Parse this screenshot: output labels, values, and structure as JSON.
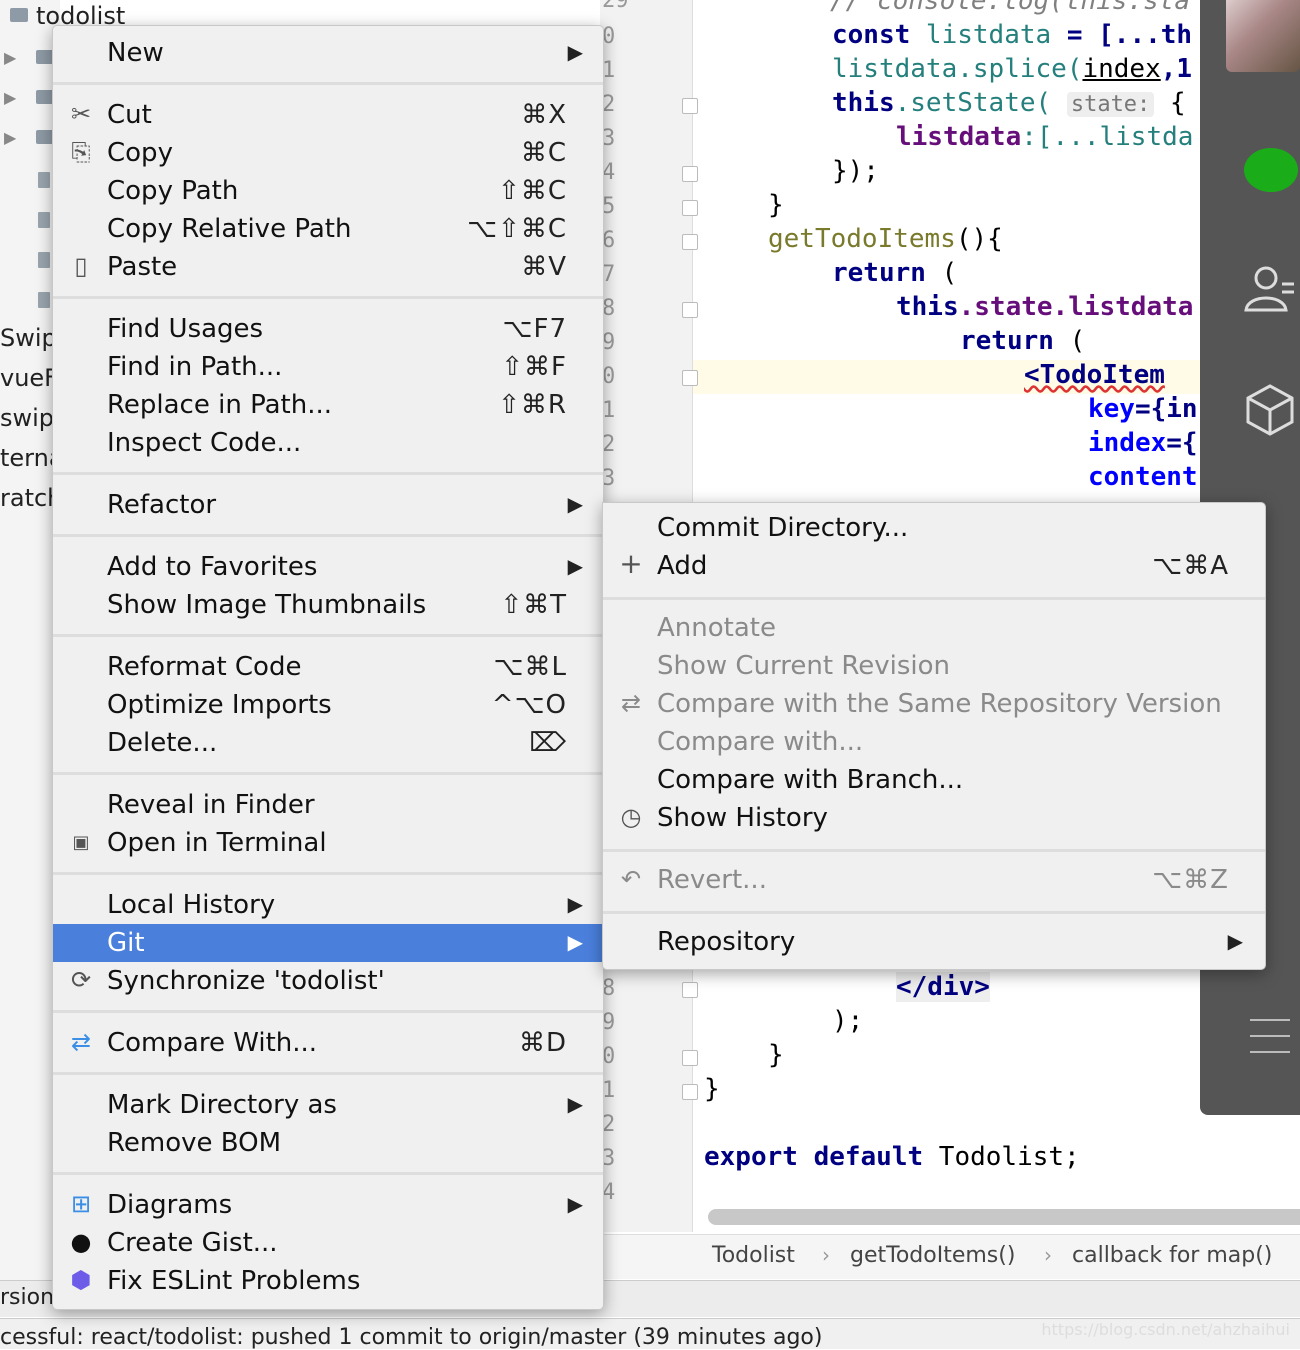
{
  "project_tree": {
    "root": "todolist",
    "partial_labels": [
      "Swip",
      "vueF",
      "swip",
      "terna",
      "ratch"
    ]
  },
  "editor": {
    "line_numbers": [
      "29",
      "0",
      "1",
      "2",
      "3",
      "4",
      "5",
      "6",
      "7",
      "8",
      "9",
      "0",
      "1",
      "2",
      "3",
      "8",
      "9",
      "0",
      "1",
      "2",
      "3",
      "4"
    ],
    "code": {
      "l0": "// console.log(this.sta",
      "l1a": "const",
      "l1b": " listdata",
      "l1c": " = [...th",
      "l2a": "listdata",
      "l2b": ".splice(",
      "l2c": "index",
      "l2d": ",1",
      "l3a": "this",
      "l3b": ".setState(",
      "l3hint": "state:",
      "l3c": " {",
      "l4a": "listdata",
      "l4b": ":[...listda",
      "l5": "});",
      "l6": "}",
      "l7a": "getTodoItems",
      "l7b": "(){",
      "l8a": "return",
      "l8b": " (",
      "l9a": "this",
      "l9b": ".state.listdata",
      "l10a": "return",
      "l10b": " (",
      "l11": "<TodoItem",
      "l12a": "key",
      "l12b": "={in",
      "l13a": "index",
      "l13b": "={",
      "l14a": "content",
      "l15": "</div>",
      "l16": ");",
      "l17": "}",
      "l18": "}",
      "l19a": "export default",
      "l19b": " Todolist;"
    },
    "breadcrumbs": [
      "Todolist",
      "getTodoItems()",
      "callback for map()"
    ]
  },
  "main_menu": {
    "items": [
      {
        "label": "New",
        "shortcut": "",
        "submenu": true
      },
      {
        "label": "Cut",
        "shortcut": "⌘X",
        "icon": "scissors-icon"
      },
      {
        "label": "Copy",
        "shortcut": "⌘C",
        "icon": "copy-icon"
      },
      {
        "label": "Copy Path",
        "shortcut": "⇧⌘C"
      },
      {
        "label": "Copy Relative Path",
        "shortcut": "⌥⇧⌘C"
      },
      {
        "label": "Paste",
        "shortcut": "⌘V",
        "icon": "paste-icon"
      },
      {
        "label": "Find Usages",
        "shortcut": "⌥F7"
      },
      {
        "label": "Find in Path...",
        "shortcut": "⇧⌘F"
      },
      {
        "label": "Replace in Path...",
        "shortcut": "⇧⌘R"
      },
      {
        "label": "Inspect Code..."
      },
      {
        "label": "Refactor",
        "submenu": true
      },
      {
        "label": "Add to Favorites",
        "submenu": true
      },
      {
        "label": "Show Image Thumbnails",
        "shortcut": "⇧⌘T"
      },
      {
        "label": "Reformat Code",
        "shortcut": "⌥⌘L"
      },
      {
        "label": "Optimize Imports",
        "shortcut": "^⌥O"
      },
      {
        "label": "Delete...",
        "shortcut": "⌦"
      },
      {
        "label": "Reveal in Finder"
      },
      {
        "label": "Open in Terminal",
        "icon": "terminal-icon"
      },
      {
        "label": "Local History",
        "submenu": true
      },
      {
        "label": "Git",
        "submenu": true,
        "selected": true
      },
      {
        "label": "Synchronize 'todolist'",
        "icon": "sync-icon"
      },
      {
        "label": "Compare With...",
        "shortcut": "⌘D",
        "icon": "compare-icon"
      },
      {
        "label": "Mark Directory as",
        "submenu": true
      },
      {
        "label": "Remove BOM"
      },
      {
        "label": "Diagrams",
        "submenu": true,
        "icon": "diagram-icon"
      },
      {
        "label": "Create Gist...",
        "icon": "github-icon"
      },
      {
        "label": "Fix ESLint Problems",
        "icon": "eslint-icon"
      }
    ],
    "arrow_glyph": "▶"
  },
  "git_submenu": {
    "items": [
      {
        "label": "Commit Directory...",
        "enabled": true
      },
      {
        "label": "Add",
        "shortcut": "⌥⌘A",
        "icon": "plus-icon",
        "enabled": true
      },
      {
        "label": "Annotate",
        "enabled": false
      },
      {
        "label": "Show Current Revision",
        "enabled": false
      },
      {
        "label": "Compare with the Same Repository Version",
        "enabled": false,
        "icon": "compare-icon"
      },
      {
        "label": "Compare with...",
        "enabled": false
      },
      {
        "label": "Compare with Branch...",
        "enabled": true
      },
      {
        "label": "Show History",
        "enabled": true,
        "icon": "clock-icon"
      },
      {
        "label": "Revert...",
        "shortcut": "⌥⌘Z",
        "enabled": false,
        "icon": "revert-icon"
      },
      {
        "label": "Repository",
        "submenu": true,
        "enabled": true
      }
    ]
  },
  "bottom": {
    "tool_label": "rsion",
    "status_text": "cessful: react/todolist: pushed 1 commit to origin/master (39 minutes ago)",
    "watermark": "https://blog.csdn.net/ahzhaihui"
  },
  "colors": {
    "selection": "#4a7fdc",
    "menu_bg": "#f0f0f0",
    "dock_bg": "#555555",
    "chat_green": "#1aad19"
  }
}
